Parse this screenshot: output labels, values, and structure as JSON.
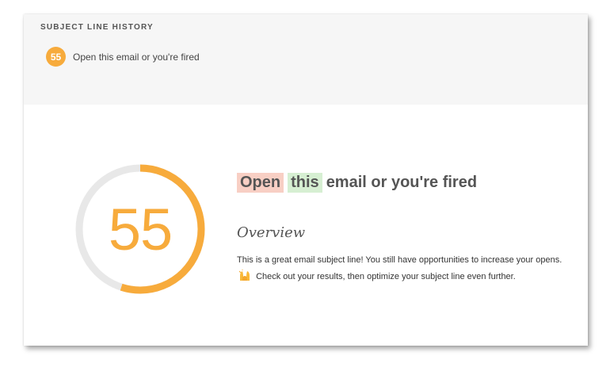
{
  "history": {
    "title": "SUBJECT LINE HISTORY",
    "items": [
      {
        "score": "55",
        "text": "Open this email or you're fired"
      }
    ]
  },
  "result": {
    "score": "55",
    "score_fraction": 0.55,
    "subject_words": {
      "highlight_red": "Open",
      "highlight_green": "this",
      "rest": "email or you're fired"
    },
    "overview_heading": "Overview",
    "description_part1": "This is a great email subject line! You still have opportunities to increase your opens.",
    "emoji_icon": "raised-hands-icon",
    "description_part2": "Check out your results, then optimize your subject line even further."
  },
  "colors": {
    "accent": "#f7ab3c",
    "track": "#e8e8e8",
    "highlight_red": "#f8cfc4",
    "highlight_green": "#d6efd2"
  }
}
